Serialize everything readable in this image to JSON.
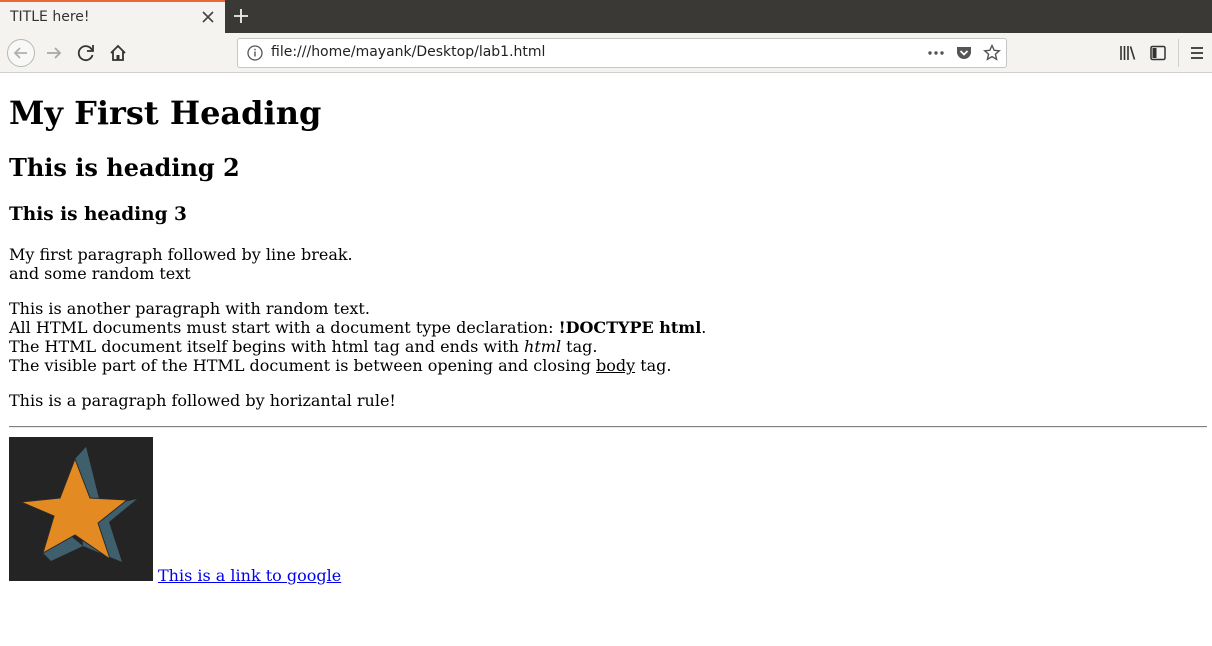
{
  "browser": {
    "tab_title": "TITLE here!",
    "url": "file:///home/mayank/Desktop/lab1.html"
  },
  "page": {
    "h1": "My First Heading",
    "h2": "This is heading 2",
    "h3": "This is heading 3",
    "p1_line1": "My first paragraph followed by line break.",
    "p1_line2": "and some random text",
    "p2_line1": "This is another paragraph with random text.",
    "p2_line2_a": "All HTML documents must start with a document type declaration: ",
    "p2_line2_b": "!DOCTYPE html",
    "p2_line2_c": ".",
    "p2_line3_a": "The HTML document itself begins with html tag and ends with ",
    "p2_line3_b": "html",
    "p2_line3_c": " tag.",
    "p2_line4_a": "The visible part of the HTML document is between opening and closing ",
    "p2_line4_b": "body",
    "p2_line4_c": " tag.",
    "p3": "This is a paragraph followed by horizantal rule!",
    "link_text": "This is a link to google"
  },
  "colors": {
    "tabbar_bg": "#3a3936",
    "toolbar_bg": "#f4f3f0",
    "tab_accent": "#e8683a",
    "link": "#0000ee",
    "star_orange": "#e38a22",
    "star_shadow": "#3f5f6d",
    "image_bg": "#242424"
  },
  "icons": {
    "tab_close": "close-icon",
    "new_tab": "plus-icon",
    "back": "back-arrow-icon",
    "forward": "forward-arrow-icon",
    "reload": "reload-icon",
    "home": "home-icon",
    "site_info": "info-icon",
    "page_actions": "ellipsis-icon",
    "pocket": "pocket-icon",
    "bookmark": "star-icon",
    "library": "library-icon",
    "sidebar": "sidebar-icon",
    "menu": "hamburger-menu-icon"
  }
}
